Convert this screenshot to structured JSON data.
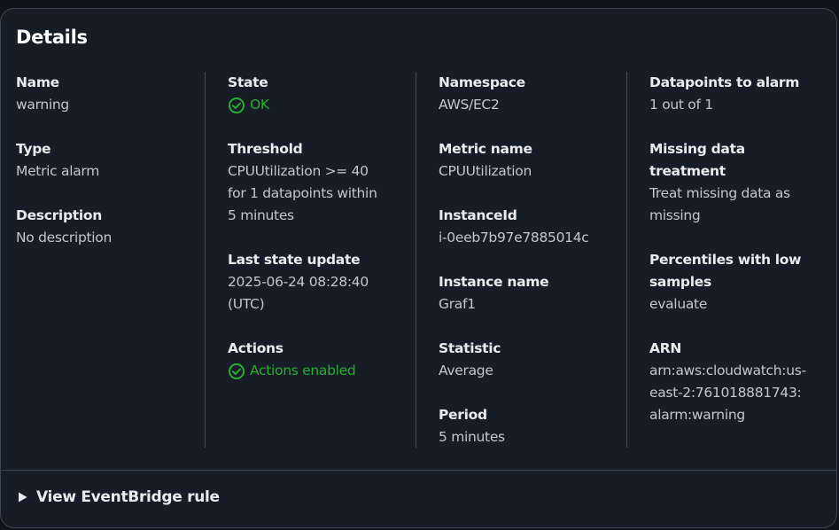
{
  "panel": {
    "title": "Details"
  },
  "columns": [
    {
      "fields": [
        {
          "label": "Name",
          "value": "warning"
        },
        {
          "label": "Type",
          "value": "Metric alarm"
        },
        {
          "label": "Description",
          "value": "No description"
        }
      ]
    },
    {
      "fields": [
        {
          "label": "State",
          "value": "OK",
          "status": "success"
        },
        {
          "label": "Threshold",
          "value_lines": [
            "CPUUtilization >= 40",
            "for 1 datapoints within",
            "5 minutes"
          ]
        },
        {
          "label": "Last state update",
          "value_lines": [
            "2025-06-24 08:28:40",
            "(UTC)"
          ]
        },
        {
          "label": "Actions",
          "value": "Actions enabled",
          "status": "success"
        }
      ]
    },
    {
      "fields": [
        {
          "label": "Namespace",
          "value": "AWS/EC2"
        },
        {
          "label": "Metric name",
          "value": "CPUUtilization"
        },
        {
          "label": "InstanceId",
          "value": "i-0eeb7b97e7885014c"
        },
        {
          "label": "Instance name",
          "value": "Graf1"
        },
        {
          "label": "Statistic",
          "value": "Average"
        },
        {
          "label": "Period",
          "value": "5 minutes"
        }
      ]
    },
    {
      "fields": [
        {
          "label": "Datapoints to alarm",
          "value": "1 out of 1"
        },
        {
          "label_lines": [
            "Missing data",
            "treatment"
          ],
          "value_lines": [
            "Treat missing data as",
            "missing"
          ]
        },
        {
          "label_lines": [
            "Percentiles with low",
            "samples"
          ],
          "value": "evaluate"
        },
        {
          "label": "ARN",
          "value_lines": [
            "arn:aws:cloudwatch:us-",
            "east-2:761018881743:",
            "alarm:warning"
          ]
        }
      ]
    }
  ],
  "footer": {
    "expander_label": "View EventBridge rule",
    "icon": "caret-right-icon"
  },
  "colors": {
    "background": "#161d26",
    "border": "#3b4654",
    "label": "#e9ebed",
    "value": "#c6c6cd",
    "success": "#29ad32"
  }
}
